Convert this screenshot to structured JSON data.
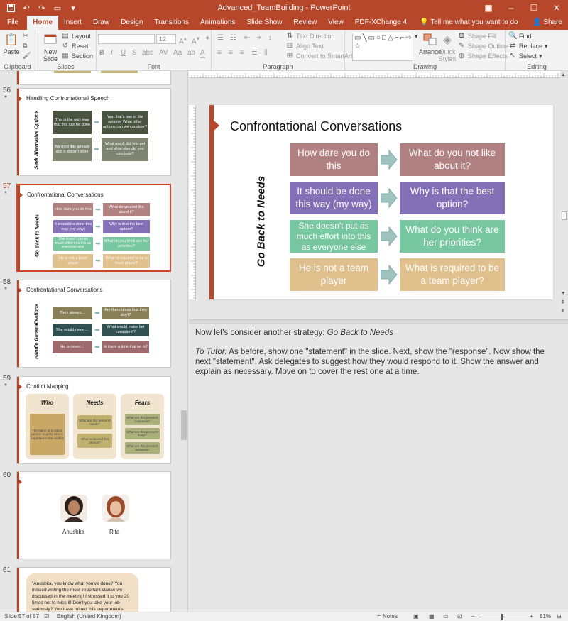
{
  "app": {
    "title": "Advanced_TeamBuilding  -  PowerPoint",
    "colors": {
      "accent": "#b7472a",
      "rose": "#b18080",
      "purple": "#8370b7",
      "mint": "#77c8a1",
      "sand": "#e0c08c",
      "arrow": "#9fc3c0"
    }
  },
  "qat": {
    "save_icon": "save-icon",
    "undo_icon": "undo-icon",
    "redo_icon": "redo-icon",
    "present_icon": "present-icon"
  },
  "window": {
    "restore_icon": "ribbon-display-icon",
    "minimize": "–",
    "maximize": "☐",
    "close": "✕"
  },
  "tabs": [
    "File",
    "Home",
    "Insert",
    "Draw",
    "Design",
    "Transitions",
    "Animations",
    "Slide Show",
    "Review",
    "View",
    "PDF-XChange 4"
  ],
  "tell_me": "Tell me what you want to do",
  "share": "Share",
  "ribbon": {
    "clipboard": {
      "label": "Clipboard",
      "paste": "Paste"
    },
    "slides": {
      "label": "Slides",
      "new_slide": "New Slide",
      "layout": "Layout",
      "reset": "Reset",
      "section": "Section"
    },
    "font": {
      "label": "Font",
      "size": "12"
    },
    "paragraph": {
      "label": "Paragraph",
      "text_direction": "Text Direction",
      "align_text": "Align Text",
      "smartart": "Convert to SmartArt"
    },
    "drawing": {
      "label": "Drawing",
      "arrange": "Arrange",
      "quick_styles": "Quick Styles",
      "shape_fill": "Shape Fill",
      "shape_outline": "Shape Outline",
      "shape_effects": "Shape Effects"
    },
    "editing": {
      "label": "Editing",
      "find": "Find",
      "replace": "Replace",
      "select": "Select"
    }
  },
  "thumbnails": {
    "s56": {
      "num": "56",
      "star": "*",
      "title": "Handling Confrontational Speech",
      "vtext": "Seek Alternative Options",
      "rows": [
        [
          "This is the only way that this can be done",
          "Yes, that's one of the options. What other options can we consider?"
        ],
        [
          "We tried this already and it doesn't work",
          "What result did you get and what else did you conclude?"
        ]
      ]
    },
    "s57": {
      "num": "57",
      "star": "*",
      "title": "Confrontational Conversations",
      "vtext": "Go Back to Needs",
      "rows": [
        [
          "How dare you do this",
          "What do you not like about it?"
        ],
        [
          "It should be done this way (my way)",
          "Why is that the best option?"
        ],
        [
          "She doesn't put as much effort into this as everyone else",
          "What do you think are her priorities?"
        ],
        [
          "He is not a team player",
          "What is required to be a team player?"
        ]
      ]
    },
    "s58": {
      "num": "58",
      "star": "*",
      "title": "Confrontational Conversations",
      "vtext": "Handle Generalisations",
      "rows": [
        [
          "They always…",
          "Are there times that they don't?"
        ],
        [
          "She would never…",
          "What would make her consider it?"
        ],
        [
          "He is never…",
          "Is there a time that he is?"
        ]
      ]
    },
    "s59": {
      "num": "59",
      "star": "*",
      "title": "Conflict Mapping",
      "cols": [
        {
          "head": "Who",
          "items": [
            "The name of a critical person or party who is important in the conflict"
          ]
        },
        {
          "head": "Needs",
          "items": [
            "What are this person's needs?",
            "What motivated this person?"
          ]
        },
        {
          "head": "Fears",
          "items": [
            "What are this person's concerns?",
            "What are this person's fears?",
            "What are this person's anxieties?"
          ]
        }
      ]
    },
    "s60": {
      "num": "60",
      "people": [
        "Anushka",
        "Rita"
      ]
    },
    "s61": {
      "num": "61",
      "quote": "\"Anushka, you know what you've done? You missed writing the most important clause we discussed in the meeting! I stressed it to you 20 times not to miss it! Don't you take your job seriously? You have ruined this department's"
    }
  },
  "slide": {
    "title": "Confrontational Conversations",
    "vertical_label": "Go Back to Needs",
    "statements": [
      "How dare you do this",
      "It should be done this way (my way)",
      "She doesn't put as much effort into this as everyone else",
      "He is not a team player"
    ],
    "responses": [
      "What do you not like about it?",
      "Why is that the best option?",
      "What do you think are her priorities?",
      "What is required to be a team player?"
    ]
  },
  "notes": {
    "line1_plain": "Now let's consider another strategy: ",
    "line1_italic": "Go Back to Needs",
    "line2_italic": "To Tutor:",
    "line2_plain": " As before, show one \"statement\" in the slide. Next, show the \"response\". Now show the next \"statement\". Ask delegates to suggest how they would respond to it. Show the answer and explain as necessary. Move on to cover the rest one at a time."
  },
  "status": {
    "slide_of": "Slide 57 of 87",
    "language": "English (United Kingdom)",
    "notes": "Notes",
    "zoom": "61%"
  }
}
